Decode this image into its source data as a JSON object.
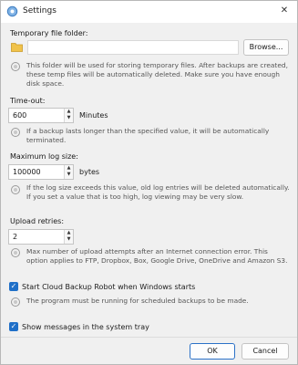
{
  "window": {
    "title": "Settings",
    "icon": "gear-icon",
    "close_glyph": "✕"
  },
  "temp_folder": {
    "label": "Temporary file folder:",
    "path": "",
    "browse_label": "Browse...",
    "description": "This folder will be used for storing temporary files. After backups are created, these temp files will be automatically deleted. Make sure you have enough disk space."
  },
  "timeout": {
    "label": "Time-out:",
    "value": "600",
    "unit": "Minutes",
    "description": "If a backup lasts longer than the specified value, it will be automatically terminated."
  },
  "log_size": {
    "label": "Maximum log size:",
    "value": "100000",
    "unit": "bytes",
    "description": "If the log size exceeds this value, old log entries will be deleted automatically. If you set a value that is too high, log viewing may be very slow."
  },
  "upload_retries": {
    "label": "Upload retries:",
    "value": "2",
    "description": "Max number of upload attempts after an Internet connection error. This option applies to FTP, Dropbox, Box, Google Drive, OneDrive and Amazon S3."
  },
  "startup": {
    "label": "Start Cloud Backup Robot when Windows starts",
    "checked": true,
    "description": "The program must be running for scheduled backups to be made."
  },
  "tray": {
    "label": "Show messages in the system tray",
    "checked": true
  },
  "footer": {
    "ok_label": "OK",
    "cancel_label": "Cancel"
  },
  "colors": {
    "accent": "#1f6fc8",
    "folder": "#e8b53a"
  }
}
